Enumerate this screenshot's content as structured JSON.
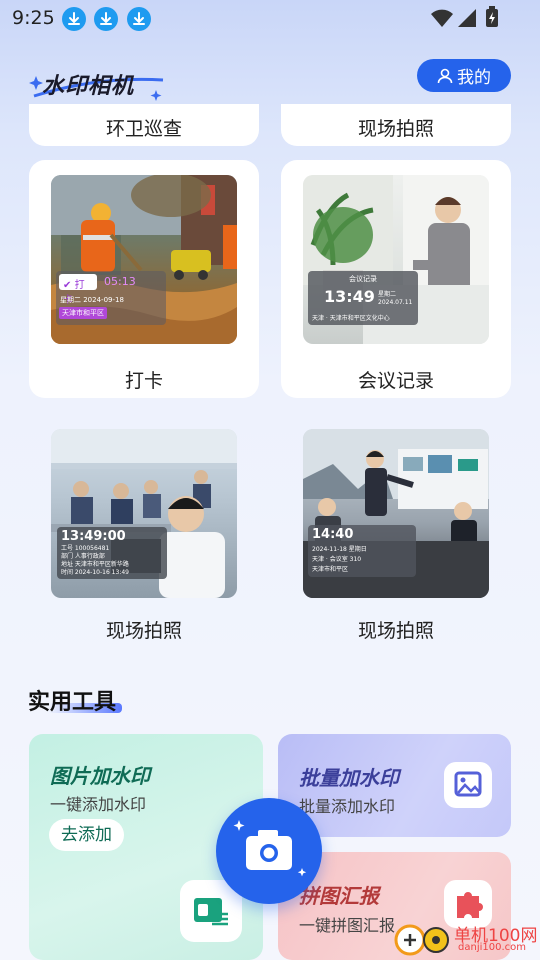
{
  "status_bar": {
    "time": "9:25",
    "notification_icons": [
      "download-icon",
      "download-icon",
      "download-icon"
    ],
    "system_icons": [
      "wifi-icon",
      "signal-icon",
      "battery-charging-icon"
    ]
  },
  "header": {
    "logo_text": "水印相机",
    "mine_button": "我的"
  },
  "top_cards": [
    {
      "label": "环卫巡查"
    },
    {
      "label": "现场拍照"
    }
  ],
  "templates": [
    {
      "label": "打卡",
      "watermark": {
        "tag": "打卡",
        "time": "05:13",
        "line1": "星期二 2024-09-18",
        "line2": "天津市和平区"
      }
    },
    {
      "label": "会议记录",
      "watermark": {
        "header": "会议记录",
        "time": "13:49",
        "date": "星期二",
        "date2": "2024.07.11",
        "footer": "天津 · 天津市和平区文化中心"
      }
    },
    {
      "label": "现场拍照",
      "watermark": {
        "time": "13:49:00",
        "rows": [
          "工号 100056481",
          "部门 人事行政部",
          "地址 天津市和平区新华路",
          "时间 2024-10-16 13:49"
        ]
      }
    },
    {
      "label": "现场拍照",
      "watermark": {
        "time": "14:40",
        "date": "2024-11-18 星期日",
        "line1": "天津 · 会议室 310",
        "line2": "天津市和平区"
      }
    }
  ],
  "tools_section": {
    "title": "实用工具",
    "tools": [
      {
        "title": "图片加水印",
        "subtitle": "一键添加水印",
        "button": "去添加",
        "icon": "image-watermark-icon",
        "color": "#0f6b55"
      },
      {
        "title": "批量加水印",
        "subtitle": "批量添加水印",
        "icon": "image-icon",
        "color": "#3b3f9a"
      },
      {
        "title": "拼图汇报",
        "subtitle": "一键拼图汇报",
        "icon": "puzzle-icon",
        "color": "#b33a3a"
      }
    ],
    "camera_button": "camera-icon"
  },
  "site_watermark": {
    "text": "单机100网",
    "sub": "danji100.com"
  },
  "colors": {
    "accent": "#2563eb",
    "green_card": "#bfeee0",
    "purple_card": "#c8caf8",
    "red_card": "#f8c9ca"
  }
}
